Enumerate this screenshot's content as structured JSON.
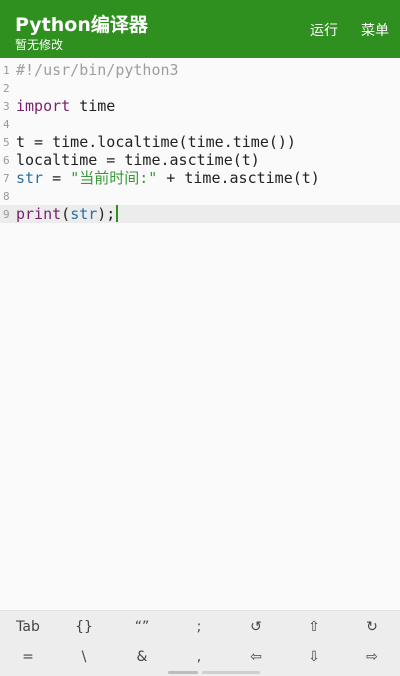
{
  "appbar": {
    "title": "Python编译器",
    "subtitle": "暂无修改",
    "run_label": "运行",
    "menu_label": "菜单"
  },
  "editor": {
    "lines": [
      {
        "num": "1",
        "code": "#!/usr/bin/python3"
      },
      {
        "num": "2",
        "code": ""
      },
      {
        "num": "3",
        "code": "import time"
      },
      {
        "num": "4",
        "code": ""
      },
      {
        "num": "5",
        "code": "t = time.localtime(time.time())"
      },
      {
        "num": "6",
        "code": "localtime = time.asctime(t)"
      },
      {
        "num": "7",
        "code": "str = \"当前时间:\" + time.asctime(t)"
      },
      {
        "num": "8",
        "code": ""
      },
      {
        "num": "9",
        "code": "print(str);"
      }
    ],
    "current_line": 9
  },
  "keybar": {
    "row1": [
      "Tab",
      "{}",
      "“”",
      ";",
      "↺",
      "⇧",
      "↻"
    ],
    "row2": [
      "=",
      "\\",
      "&",
      ",",
      "⇦",
      "⇩",
      "⇨"
    ]
  },
  "colors": {
    "accent": "#2f8f1f",
    "keyword": "#7a1f6e",
    "builtin": "#2a6ea0",
    "string": "#3a9a3a",
    "comment": "#9e9e9e"
  }
}
